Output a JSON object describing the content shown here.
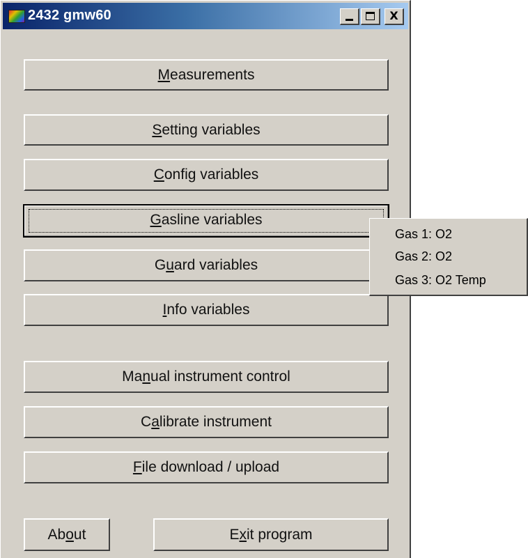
{
  "window": {
    "title": "2432 gmw60",
    "controls": {
      "minimize": "_",
      "maximize": "□",
      "close": "X"
    }
  },
  "buttons": [
    {
      "id": "measurements",
      "pre": "",
      "u": "M",
      "post": "easurements"
    },
    {
      "id": "setting",
      "pre": "",
      "u": "S",
      "post": "etting variables"
    },
    {
      "id": "config",
      "pre": "",
      "u": "C",
      "post": "onfig variables"
    },
    {
      "id": "gasline",
      "pre": "",
      "u": "G",
      "post": "asline variables"
    },
    {
      "id": "guard",
      "pre": "G",
      "u": "u",
      "post": "ard variables"
    },
    {
      "id": "info",
      "pre": "",
      "u": "I",
      "post": "nfo variables"
    },
    {
      "id": "manual",
      "pre": "Ma",
      "u": "n",
      "post": "ual instrument control"
    },
    {
      "id": "calibrate",
      "pre": "C",
      "u": "a",
      "post": "librate instrument"
    },
    {
      "id": "file",
      "pre": "",
      "u": "F",
      "post": "ile download / upload"
    },
    {
      "id": "about",
      "pre": "Ab",
      "u": "o",
      "post": "ut"
    },
    {
      "id": "exit",
      "pre": "E",
      "u": "x",
      "post": "it program"
    }
  ],
  "gas_popup": {
    "items": [
      "Gas 1: O2",
      "Gas 2: O2",
      "Gas 3: O2 Temp"
    ]
  },
  "focused_button": "gasline"
}
